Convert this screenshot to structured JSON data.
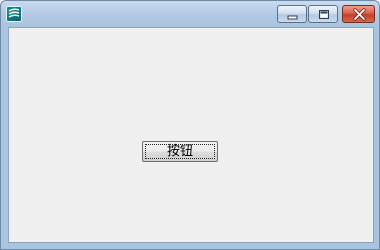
{
  "window": {
    "title": "",
    "icon": "app-icon",
    "controls": {
      "minimize_icon": "minimize-icon",
      "maximize_icon": "maximize-icon",
      "close_icon": "close-icon"
    }
  },
  "main": {
    "button_label": "按钮"
  },
  "colors": {
    "client_background": "#f0f0f0",
    "frame": "#a9c4e0",
    "close_button": "#c2402a"
  }
}
